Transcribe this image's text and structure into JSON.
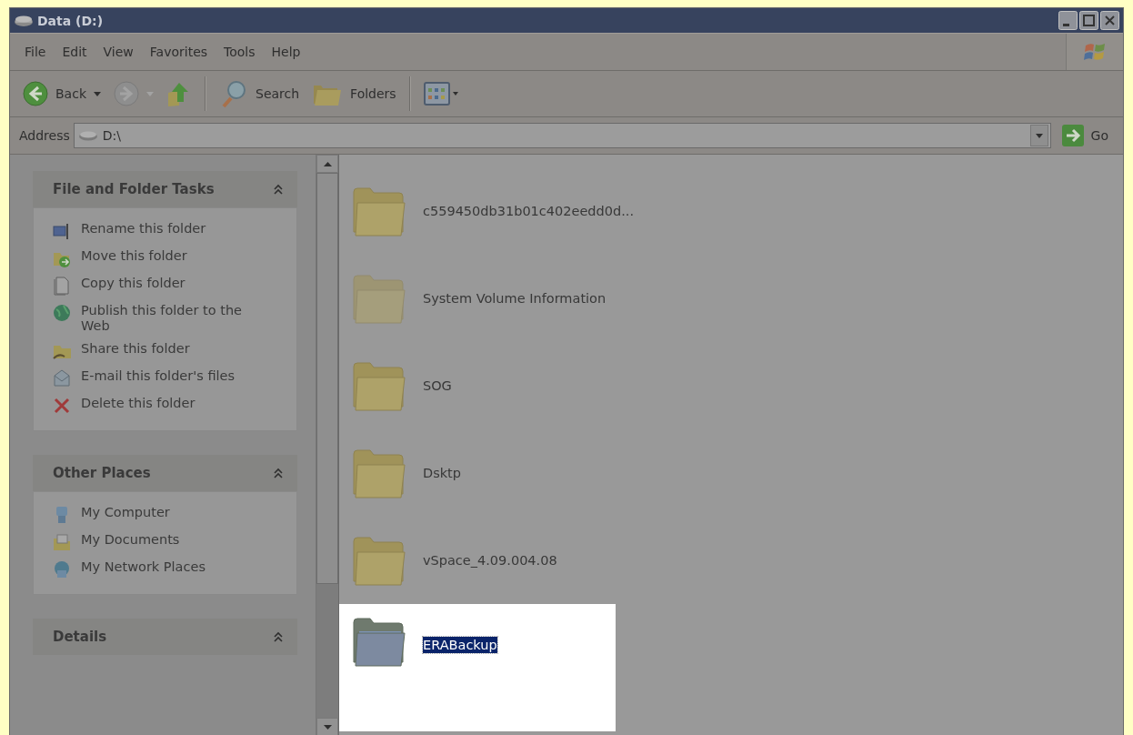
{
  "window": {
    "title": "Data (D:)"
  },
  "menu": [
    {
      "label": "File"
    },
    {
      "label": "Edit"
    },
    {
      "label": "View"
    },
    {
      "label": "Favorites"
    },
    {
      "label": "Tools"
    },
    {
      "label": "Help"
    }
  ],
  "toolbar": [
    {
      "kind": "back",
      "label": "Back",
      "disabled": false
    },
    {
      "kind": "forward",
      "disabled": true
    },
    {
      "kind": "up",
      "disabled": false
    },
    {
      "kind": "search",
      "label": "Search",
      "disabled": false
    },
    {
      "kind": "folders",
      "label": "Folders",
      "disabled": false
    },
    {
      "kind": "views",
      "disabled": false
    }
  ],
  "address": {
    "label": "Address",
    "value": "D:\\",
    "go": "Go"
  },
  "task_groups": [
    {
      "title": "File and Folder Tasks",
      "expanded": true,
      "items": [
        {
          "label": "Rename this folder"
        },
        {
          "label": "Move this folder"
        },
        {
          "label": "Copy this folder"
        },
        {
          "label": "Publish this folder to the Web"
        },
        {
          "label": "Share this folder"
        },
        {
          "label": "E-mail this folder's files"
        },
        {
          "label": "Delete this folder"
        }
      ]
    },
    {
      "title": "Other Places",
      "expanded": true,
      "items": [
        {
          "label": "My Computer"
        },
        {
          "label": "My Documents"
        },
        {
          "label": "My Network Places"
        }
      ]
    },
    {
      "title": "Details",
      "expanded": true
    }
  ],
  "files": [
    {
      "name": "c559450db31b01c402eedd0d...",
      "hidden": false,
      "selected": false
    },
    {
      "name": "System Volume Information",
      "hidden": true,
      "selected": false
    },
    {
      "name": "SOG",
      "hidden": false,
      "selected": false
    },
    {
      "name": "Dsktp",
      "hidden": false,
      "selected": false
    },
    {
      "name": "vSpace_4.09.004.08",
      "hidden": false,
      "selected": false
    },
    {
      "name": "ERABackup",
      "hidden": false,
      "selected": true
    }
  ]
}
